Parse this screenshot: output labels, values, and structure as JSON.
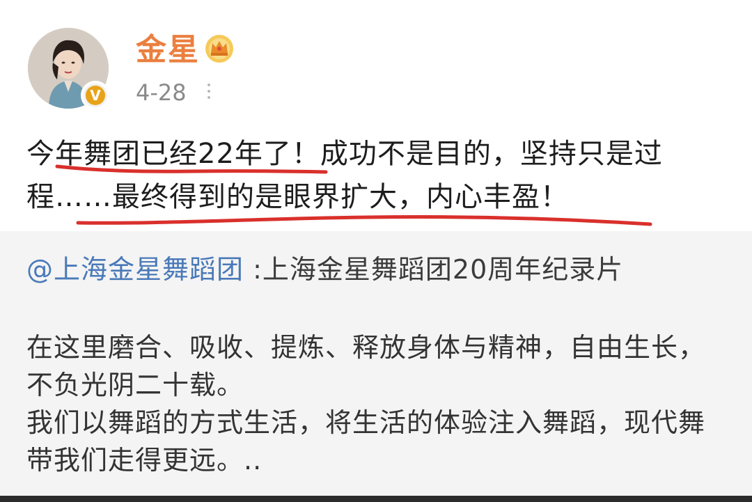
{
  "post": {
    "username": "金星",
    "date": "4-28",
    "text": "今年舞团已经22年了！成功不是目的，坚持只是过程……最终得到的是眼界扩大，内心丰盈！",
    "verified_mark": "V"
  },
  "repost": {
    "mention": "@上海金星舞蹈团",
    "title": " :上海金星舞蹈团20周年纪录片",
    "paragraph_1": "在这里磨合、吸收、提炼、释放身体与精神，自由生长，不负光阴二十载。",
    "paragraph_2": "我们以舞蹈的方式生活，将生活的体验注入舞蹈，现代舞带我们走得更远。.."
  },
  "icons": {
    "avatar": "avatar-photo",
    "verified": "verified-badge-icon",
    "crown": "crown-icon",
    "more": "more-options-icon"
  },
  "colors": {
    "username": "#eb7f3f",
    "mention": "#4a79b8",
    "underline": "#d9302c",
    "verified": "#e8a318"
  }
}
